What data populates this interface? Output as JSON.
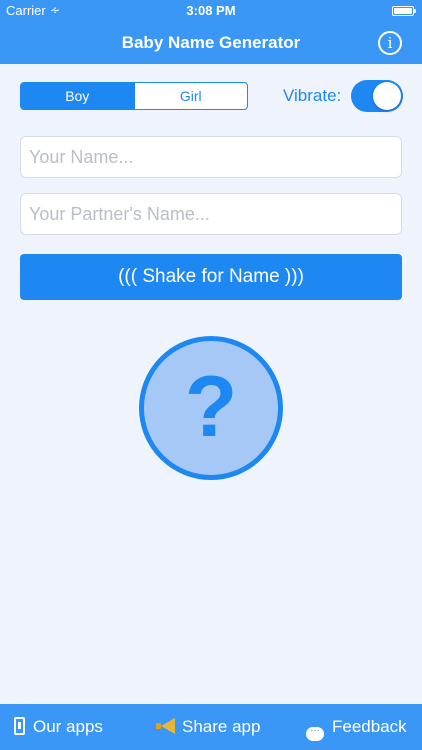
{
  "status_bar": {
    "carrier": "Carrier",
    "time": "3:08 PM"
  },
  "nav": {
    "title": "Baby Name Generator",
    "info_icon": "info-icon"
  },
  "gender": {
    "options": [
      "Boy",
      "Girl"
    ],
    "selected": "Boy"
  },
  "vibrate": {
    "label": "Vibrate:",
    "on": true
  },
  "inputs": {
    "your_name_placeholder": "Your Name...",
    "partner_name_placeholder": "Your Partner's Name...",
    "your_name_value": "",
    "partner_name_value": ""
  },
  "shake_button": {
    "label": "((( Shake for Name )))"
  },
  "result": {
    "symbol": "?"
  },
  "bottom_bar": {
    "our_apps": "Our apps",
    "share_app": "Share app",
    "feedback": "Feedback"
  },
  "colors": {
    "accent": "#1e88f2",
    "bar": "#3b97f5",
    "background": "#eef3fc",
    "result_fill": "#a6c8f6"
  }
}
